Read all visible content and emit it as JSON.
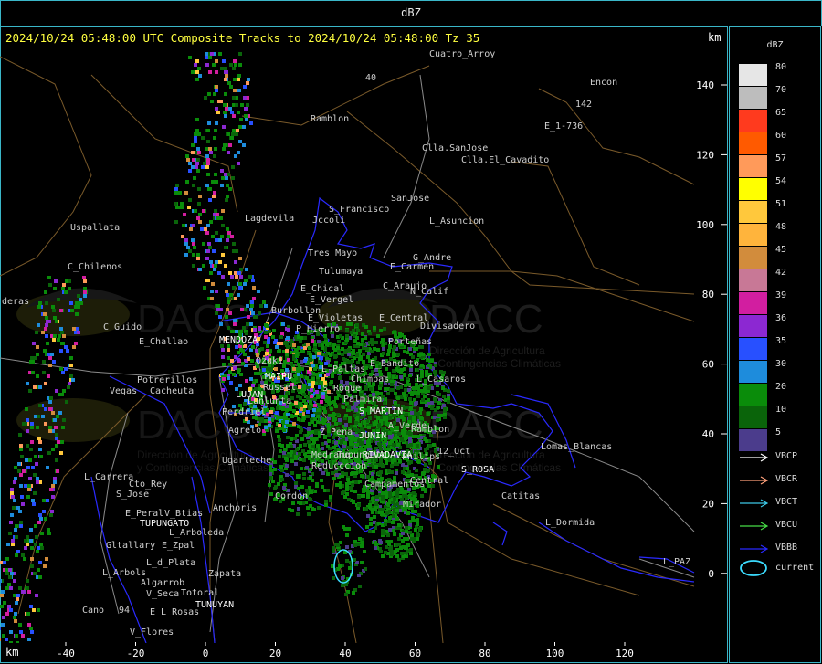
{
  "window_title": "dBZ",
  "header_text": "2024/10/24 05:48:00 UTC Composite Tracks to 2024/10/24 05:48:00 Tz 35",
  "unit_top": "km",
  "unit_bottom": "km",
  "x_ticks": [
    "-40",
    "-20",
    "0",
    "20",
    "40",
    "60",
    "80",
    "100",
    "120"
  ],
  "y_ticks": [
    "140",
    "120",
    "100",
    "80",
    "60",
    "40",
    "20",
    "0"
  ],
  "legend": {
    "title": "dBZ",
    "scale": [
      {
        "label": "80",
        "color": "#e6e6e6"
      },
      {
        "label": "70",
        "color": "#bdbdbd"
      },
      {
        "label": "65",
        "color": "#ff3a1e"
      },
      {
        "label": "60",
        "color": "#ff5a00"
      },
      {
        "label": "57",
        "color": "#ff9a5a"
      },
      {
        "label": "54",
        "color": "#ffff00"
      },
      {
        "label": "51",
        "color": "#ffc83c"
      },
      {
        "label": "48",
        "color": "#ffb43c"
      },
      {
        "label": "45",
        "color": "#d28c3c"
      },
      {
        "label": "42",
        "color": "#c87896"
      },
      {
        "label": "39",
        "color": "#d21ea0"
      },
      {
        "label": "36",
        "color": "#8c28d2"
      },
      {
        "label": "35",
        "color": "#2850ff"
      },
      {
        "label": "30",
        "color": "#1e8cdc"
      },
      {
        "label": "20",
        "color": "#0a8c0a"
      },
      {
        "label": "10",
        "color": "#0a640a"
      },
      {
        "label": "5",
        "color": "#4b3c8c"
      }
    ],
    "tracks": [
      {
        "label": "VBCP",
        "color": "#ffffff"
      },
      {
        "label": "VBCR",
        "color": "#ffa07a"
      },
      {
        "label": "VBCT",
        "color": "#3cc8e6"
      },
      {
        "label": "VBCU",
        "color": "#46dc46"
      },
      {
        "label": "VBBB",
        "color": "#2828ff"
      }
    ],
    "current_label": "current",
    "current_color": "#3cdcff"
  },
  "watermark": {
    "name": "DACC",
    "line1": "Dirección de Agricultura",
    "line2": "y Contingencias Climáticas"
  },
  "places": [
    {
      "name": "Ramblon",
      "x": 340,
      "y": 72,
      "w": false
    },
    {
      "name": "Encon",
      "x": 646,
      "y": 32,
      "w": false
    },
    {
      "name": "E_1-736",
      "x": 596,
      "y": 80,
      "w": false
    },
    {
      "name": "142",
      "x": 630,
      "y": 56,
      "w": false
    },
    {
      "name": "Clla.SanJose",
      "x": 462,
      "y": 104,
      "w": false
    },
    {
      "name": "Clla.El_Cavadito",
      "x": 505,
      "y": 117,
      "w": false
    },
    {
      "name": "SanJose",
      "x": 428,
      "y": 159,
      "w": false
    },
    {
      "name": "S_Francisco",
      "x": 360,
      "y": 171,
      "w": false
    },
    {
      "name": "Jccoli",
      "x": 342,
      "y": 183,
      "w": false
    },
    {
      "name": "L_Asuncion",
      "x": 470,
      "y": 184,
      "w": false
    },
    {
      "name": "Lagdevila",
      "x": 268,
      "y": 181,
      "w": false
    },
    {
      "name": "Uspallata",
      "x": 77,
      "y": 191,
      "w": false
    },
    {
      "name": "Tres_Mayo",
      "x": 337,
      "y": 219,
      "w": false
    },
    {
      "name": "G_Andre",
      "x": 452,
      "y": 224,
      "w": false
    },
    {
      "name": "Tulumaya",
      "x": 349,
      "y": 239,
      "w": false
    },
    {
      "name": "E_Carmen",
      "x": 427,
      "y": 234,
      "w": false
    },
    {
      "name": "C_Chilenos",
      "x": 74,
      "y": 234,
      "w": false
    },
    {
      "name": "C_Araujo",
      "x": 419,
      "y": 255,
      "w": false
    },
    {
      "name": "N_Calif",
      "x": 449,
      "y": 261,
      "w": false
    },
    {
      "name": "E_Chical",
      "x": 329,
      "y": 258,
      "w": false
    },
    {
      "name": "E_Vergel",
      "x": 339,
      "y": 270,
      "w": false
    },
    {
      "name": "deras",
      "x": 2,
      "y": 272,
      "w": false
    },
    {
      "name": "Burbollon",
      "x": 297,
      "y": 282,
      "w": false
    },
    {
      "name": "E_Violetas",
      "x": 337,
      "y": 290,
      "w": false
    },
    {
      "name": "E_Central",
      "x": 415,
      "y": 290,
      "w": false
    },
    {
      "name": "Divisadero",
      "x": 460,
      "y": 299,
      "w": false
    },
    {
      "name": "C_Guido",
      "x": 113,
      "y": 300,
      "w": false
    },
    {
      "name": "P_Hierro",
      "x": 324,
      "y": 302,
      "w": false
    },
    {
      "name": "E_Challao",
      "x": 152,
      "y": 316,
      "w": false
    },
    {
      "name": "MENDOZA",
      "x": 240,
      "y": 314,
      "w": true
    },
    {
      "name": "Porteñas",
      "x": 425,
      "y": 316,
      "w": false
    },
    {
      "name": "Ozuki",
      "x": 280,
      "y": 337,
      "w": false
    },
    {
      "name": "E_Bandito",
      "x": 405,
      "y": 340,
      "w": false
    },
    {
      "name": "L_Paltas",
      "x": 352,
      "y": 346,
      "w": false
    },
    {
      "name": "MAIPU",
      "x": 290,
      "y": 354,
      "w": true
    },
    {
      "name": "Potrerillos",
      "x": 150,
      "y": 358,
      "w": false
    },
    {
      "name": "Chimbas",
      "x": 384,
      "y": 357,
      "w": false
    },
    {
      "name": "L_Casaros",
      "x": 456,
      "y": 357,
      "w": false
    },
    {
      "name": "Russel",
      "x": 288,
      "y": 366,
      "w": false
    },
    {
      "name": "Vegas",
      "x": 120,
      "y": 370,
      "w": false
    },
    {
      "name": "Cacheuta",
      "x": 164,
      "y": 370,
      "w": false
    },
    {
      "name": "S_Roque",
      "x": 353,
      "y": 367,
      "w": false
    },
    {
      "name": "LUJAN",
      "x": 258,
      "y": 374,
      "w": true
    },
    {
      "name": "Palmira",
      "x": 376,
      "y": 379,
      "w": false
    },
    {
      "name": "Lunlunta",
      "x": 271,
      "y": 381,
      "w": false
    },
    {
      "name": "S_MARTIN",
      "x": 393,
      "y": 392,
      "w": true
    },
    {
      "name": "Perdriel",
      "x": 243,
      "y": 393,
      "w": false
    },
    {
      "name": "A_Verde",
      "x": 425,
      "y": 408,
      "w": false
    },
    {
      "name": "Ramblon",
      "x": 450,
      "y": 412,
      "w": false
    },
    {
      "name": "Agrelo",
      "x": 250,
      "y": 413,
      "w": false
    },
    {
      "name": "Z_Pena",
      "x": 350,
      "y": 415,
      "w": false
    },
    {
      "name": "JUNIN",
      "x": 393,
      "y": 419,
      "w": true
    },
    {
      "name": "12_Oct",
      "x": 479,
      "y": 436,
      "w": false
    },
    {
      "name": "RIVADAVIA",
      "x": 397,
      "y": 440,
      "w": true
    },
    {
      "name": "Philips",
      "x": 440,
      "y": 442,
      "w": false
    },
    {
      "name": "Lomas_Blancas",
      "x": 592,
      "y": 431,
      "w": false
    },
    {
      "name": "Tupungato",
      "x": 369,
      "y": 440,
      "w": false
    },
    {
      "name": "Ugarteche",
      "x": 243,
      "y": 446,
      "w": false
    },
    {
      "name": "Medrano",
      "x": 341,
      "y": 440,
      "w": false
    },
    {
      "name": "Reducccion",
      "x": 341,
      "y": 452,
      "w": false
    },
    {
      "name": "S_ROSA",
      "x": 505,
      "y": 456,
      "w": true
    },
    {
      "name": "L_Carrera",
      "x": 92,
      "y": 464,
      "w": false
    },
    {
      "name": "Central",
      "x": 449,
      "y": 468,
      "w": false
    },
    {
      "name": "Campamentos",
      "x": 399,
      "y": 472,
      "w": false
    },
    {
      "name": "Cto_Rey",
      "x": 141,
      "y": 472,
      "w": false
    },
    {
      "name": "Catitas",
      "x": 549,
      "y": 485,
      "w": false
    },
    {
      "name": "S_Jose",
      "x": 127,
      "y": 483,
      "w": false
    },
    {
      "name": "Cordon",
      "x": 301,
      "y": 485,
      "w": false
    },
    {
      "name": "Mirador",
      "x": 441,
      "y": 494,
      "w": false
    },
    {
      "name": "Anchoris",
      "x": 233,
      "y": 498,
      "w": false
    },
    {
      "name": "E_Peral",
      "x": 137,
      "y": 504,
      "w": false
    },
    {
      "name": "V_Btias",
      "x": 180,
      "y": 504,
      "w": false
    },
    {
      "name": "TUPUNGATO",
      "x": 153,
      "y": 515,
      "w": true
    },
    {
      "name": "L_Dormida",
      "x": 597,
      "y": 514,
      "w": false
    },
    {
      "name": "L_Arboleda",
      "x": 185,
      "y": 525,
      "w": false
    },
    {
      "name": "Gltallary",
      "x": 116,
      "y": 539,
      "w": false
    },
    {
      "name": "E_Zpal",
      "x": 177,
      "y": 539,
      "w": false
    },
    {
      "name": "L_d_Plata",
      "x": 160,
      "y": 558,
      "w": false
    },
    {
      "name": "L_PAZ",
      "x": 726,
      "y": 557,
      "w": false
    },
    {
      "name": "L_Arbols",
      "x": 112,
      "y": 569,
      "w": false
    },
    {
      "name": "Zapata",
      "x": 228,
      "y": 570,
      "w": false
    },
    {
      "name": "Algarrob",
      "x": 154,
      "y": 580,
      "w": false
    },
    {
      "name": "V_Seca",
      "x": 160,
      "y": 592,
      "w": false
    },
    {
      "name": "Totoral",
      "x": 198,
      "y": 591,
      "w": false
    },
    {
      "name": "TUNUYAN",
      "x": 214,
      "y": 604,
      "w": true
    },
    {
      "name": "Cano",
      "x": 90,
      "y": 610,
      "w": false
    },
    {
      "name": "E_L_Rosas",
      "x": 164,
      "y": 612,
      "w": false
    },
    {
      "name": "V_Flores",
      "x": 142,
      "y": 634,
      "w": false
    },
    {
      "name": "94",
      "x": 130,
      "y": 610,
      "w": false
    },
    {
      "name": "40",
      "x": 400,
      "y": 27,
      "w": false
    },
    {
      "name": "Cuatro_Arroy",
      "x": 470,
      "y": 1,
      "w": false
    }
  ]
}
